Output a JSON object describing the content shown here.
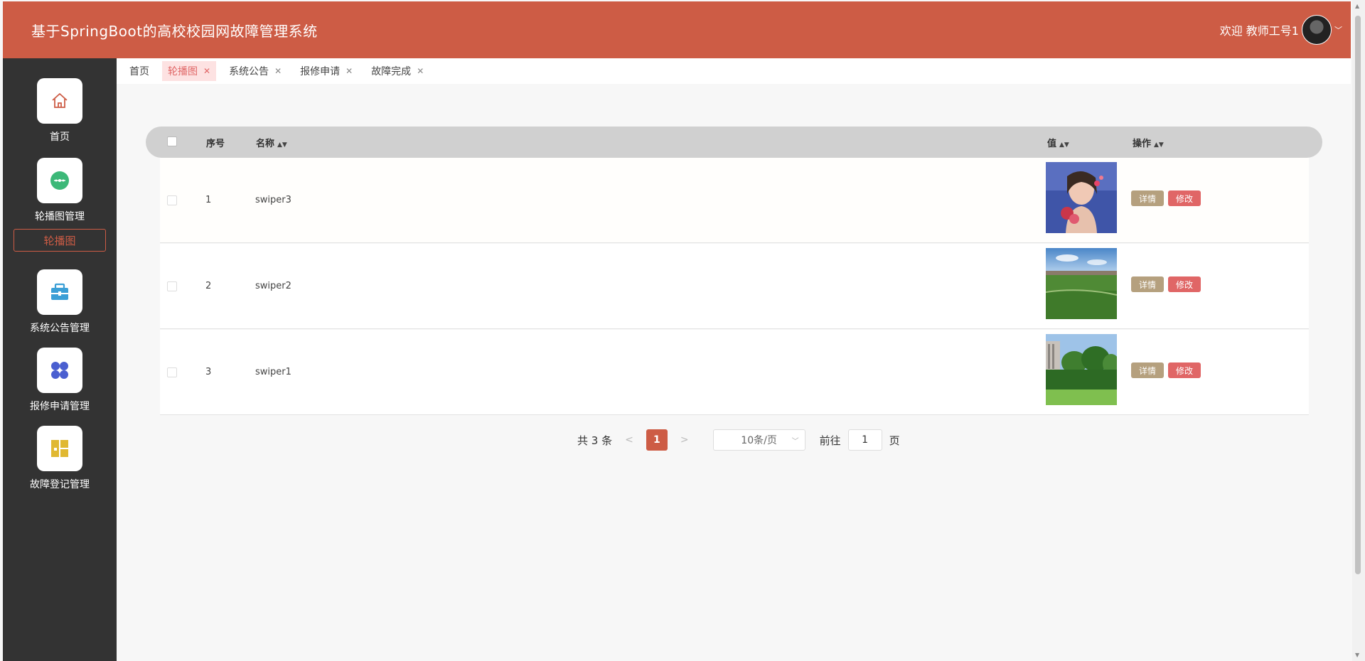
{
  "header": {
    "title": "基于SpringBoot的高校校园网故障管理系统",
    "welcome": "欢迎 教师工号1",
    "chevron": "﹀"
  },
  "sidebar": {
    "items": [
      {
        "label": "首页",
        "icon": "home-icon"
      },
      {
        "label": "轮播图管理",
        "icon": "carousel-icon"
      },
      {
        "label": "系统公告管理",
        "icon": "briefcase-icon"
      },
      {
        "label": "报修申请管理",
        "icon": "grid-icon"
      },
      {
        "label": "故障登记管理",
        "icon": "dashboard-icon"
      }
    ],
    "submenu_active": "轮播图"
  },
  "tabs": [
    {
      "label": "首页",
      "closable": false
    },
    {
      "label": "轮播图",
      "closable": true,
      "active": true
    },
    {
      "label": "系统公告",
      "closable": true
    },
    {
      "label": "报修申请",
      "closable": true
    },
    {
      "label": "故障完成",
      "closable": true
    }
  ],
  "table": {
    "headers": {
      "index": "序号",
      "name": "名称",
      "value": "值",
      "actions": "操作"
    },
    "rows": [
      {
        "index": "1",
        "name": "swiper3",
        "image": "portrait"
      },
      {
        "index": "2",
        "name": "swiper2",
        "image": "campus-field"
      },
      {
        "index": "3",
        "name": "swiper1",
        "image": "campus-trees"
      }
    ],
    "btn_detail": "详情",
    "btn_edit": "修改"
  },
  "pagination": {
    "total": "共 3 条",
    "prev": "<",
    "current": "1",
    "next": ">",
    "page_size": "10条/页",
    "goto_label": "前往",
    "goto_value": "1",
    "page_suffix": "页"
  },
  "colors": {
    "primary": "#cd5c45",
    "sidebar": "#333333",
    "detail_btn": "#b5a07e",
    "edit_btn": "#e06666"
  }
}
